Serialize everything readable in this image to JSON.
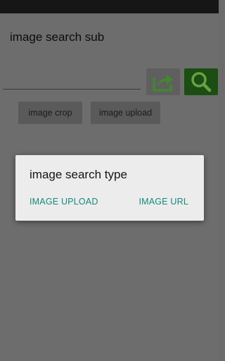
{
  "app": {
    "title": "image search sub"
  },
  "search": {
    "value": "",
    "placeholder": ""
  },
  "toolbar": {
    "share_icon": "share-icon",
    "search_icon": "magnifier-icon",
    "colors": {
      "share_icon": "#3f8a2c",
      "search_button_bg": "#1c4d12",
      "search_icon": "#6aa046"
    }
  },
  "buttons": {
    "image_crop": "image crop",
    "image_upload": "image upload"
  },
  "dialog": {
    "title": "image search type",
    "action_upload": "IMAGE UPLOAD",
    "action_url": "IMAGE URL",
    "accent_color": "#138a7e"
  }
}
